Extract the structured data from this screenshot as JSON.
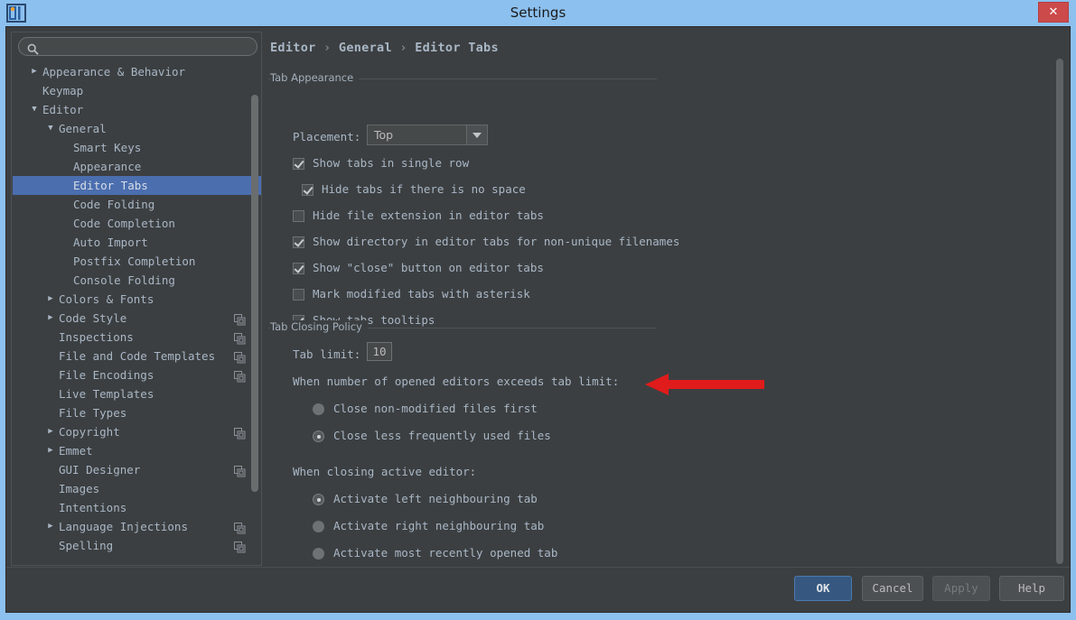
{
  "window": {
    "title": "Settings",
    "app_icon": "intellij-idea-icon",
    "close_label": "✕"
  },
  "sidebar": {
    "search": {
      "value": "",
      "placeholder": "",
      "icon": "search-icon"
    },
    "tree": [
      {
        "label": "Appearance & Behavior",
        "level": 0,
        "twisty": "▶",
        "selected": false,
        "modicon": false
      },
      {
        "label": "Keymap",
        "level": 0,
        "twisty": "",
        "selected": false,
        "modicon": false
      },
      {
        "label": "Editor",
        "level": 0,
        "twisty": "▼",
        "selected": false,
        "modicon": false
      },
      {
        "label": "General",
        "level": 1,
        "twisty": "▼",
        "selected": false,
        "modicon": false
      },
      {
        "label": "Smart Keys",
        "level": 2,
        "twisty": "",
        "selected": false,
        "modicon": false
      },
      {
        "label": "Appearance",
        "level": 2,
        "twisty": "",
        "selected": false,
        "modicon": false
      },
      {
        "label": "Editor Tabs",
        "level": 2,
        "twisty": "",
        "selected": true,
        "modicon": false
      },
      {
        "label": "Code Folding",
        "level": 2,
        "twisty": "",
        "selected": false,
        "modicon": false
      },
      {
        "label": "Code Completion",
        "level": 2,
        "twisty": "",
        "selected": false,
        "modicon": false
      },
      {
        "label": "Auto Import",
        "level": 2,
        "twisty": "",
        "selected": false,
        "modicon": false
      },
      {
        "label": "Postfix Completion",
        "level": 2,
        "twisty": "",
        "selected": false,
        "modicon": false
      },
      {
        "label": "Console Folding",
        "level": 2,
        "twisty": "",
        "selected": false,
        "modicon": false
      },
      {
        "label": "Colors & Fonts",
        "level": 1,
        "twisty": "▶",
        "selected": false,
        "modicon": false
      },
      {
        "label": "Code Style",
        "level": 1,
        "twisty": "▶",
        "selected": false,
        "modicon": true
      },
      {
        "label": "Inspections",
        "level": 1,
        "twisty": "",
        "selected": false,
        "modicon": true
      },
      {
        "label": "File and Code Templates",
        "level": 1,
        "twisty": "",
        "selected": false,
        "modicon": true
      },
      {
        "label": "File Encodings",
        "level": 1,
        "twisty": "",
        "selected": false,
        "modicon": true
      },
      {
        "label": "Live Templates",
        "level": 1,
        "twisty": "",
        "selected": false,
        "modicon": false
      },
      {
        "label": "File Types",
        "level": 1,
        "twisty": "",
        "selected": false,
        "modicon": false
      },
      {
        "label": "Copyright",
        "level": 1,
        "twisty": "▶",
        "selected": false,
        "modicon": true
      },
      {
        "label": "Emmet",
        "level": 1,
        "twisty": "▶",
        "selected": false,
        "modicon": false
      },
      {
        "label": "GUI Designer",
        "level": 1,
        "twisty": "",
        "selected": false,
        "modicon": true
      },
      {
        "label": "Images",
        "level": 1,
        "twisty": "",
        "selected": false,
        "modicon": false
      },
      {
        "label": "Intentions",
        "level": 1,
        "twisty": "",
        "selected": false,
        "modicon": false
      },
      {
        "label": "Language Injections",
        "level": 1,
        "twisty": "▶",
        "selected": false,
        "modicon": true
      },
      {
        "label": "Spelling",
        "level": 1,
        "twisty": "",
        "selected": false,
        "modicon": true
      }
    ]
  },
  "main": {
    "breadcrumb": {
      "part1": "Editor",
      "sep": "›",
      "part2": "General",
      "part3": "Editor Tabs"
    },
    "tab_appearance": {
      "title": "Tab Appearance",
      "placement_label": "Placement:",
      "placement_value": "Top",
      "checkboxes": [
        {
          "label": "Show tabs in single row",
          "checked": true,
          "indent": 0
        },
        {
          "label": "Hide tabs if there is no space",
          "checked": true,
          "indent": 1
        },
        {
          "label": "Hide file extension in editor tabs",
          "checked": false,
          "indent": 0
        },
        {
          "label": "Show directory in editor tabs for non-unique filenames",
          "checked": true,
          "indent": 0
        },
        {
          "label": "Show \"close\" button on editor tabs",
          "checked": true,
          "indent": 0
        },
        {
          "label": "Mark modified tabs with asterisk",
          "checked": false,
          "indent": 0
        },
        {
          "label": "Show tabs tooltips",
          "checked": true,
          "indent": 0
        }
      ]
    },
    "tab_closing_policy": {
      "title": "Tab Closing Policy",
      "tab_limit_label": "Tab limit:",
      "tab_limit_value": "10",
      "exceeds_label": "When number of opened editors exceeds tab limit:",
      "exceeds_options": [
        {
          "label": "Close non-modified files first",
          "selected": false
        },
        {
          "label": "Close less frequently used files",
          "selected": true
        }
      ],
      "closing_label": "When closing active editor:",
      "closing_options": [
        {
          "label": "Activate left neighbouring tab",
          "selected": true
        },
        {
          "label": "Activate right neighbouring tab",
          "selected": false
        },
        {
          "label": "Activate most recently opened tab",
          "selected": false
        }
      ]
    },
    "annotation": {
      "name": "red-arrow-pointing-to-tab-limit",
      "color": "#e01b1b",
      "direction": "left"
    }
  },
  "buttons": {
    "ok": "OK",
    "cancel": "Cancel",
    "apply": "Apply",
    "help": "Help"
  },
  "colors": {
    "titlebar": "#8cc0ee",
    "panel_bg": "#3c3f41",
    "text": "#a9b7c6",
    "selection": "#4b6eaf",
    "ok_button": "#365880",
    "close_button": "#cc4a4a",
    "annotation_red": "#e01b1b"
  }
}
